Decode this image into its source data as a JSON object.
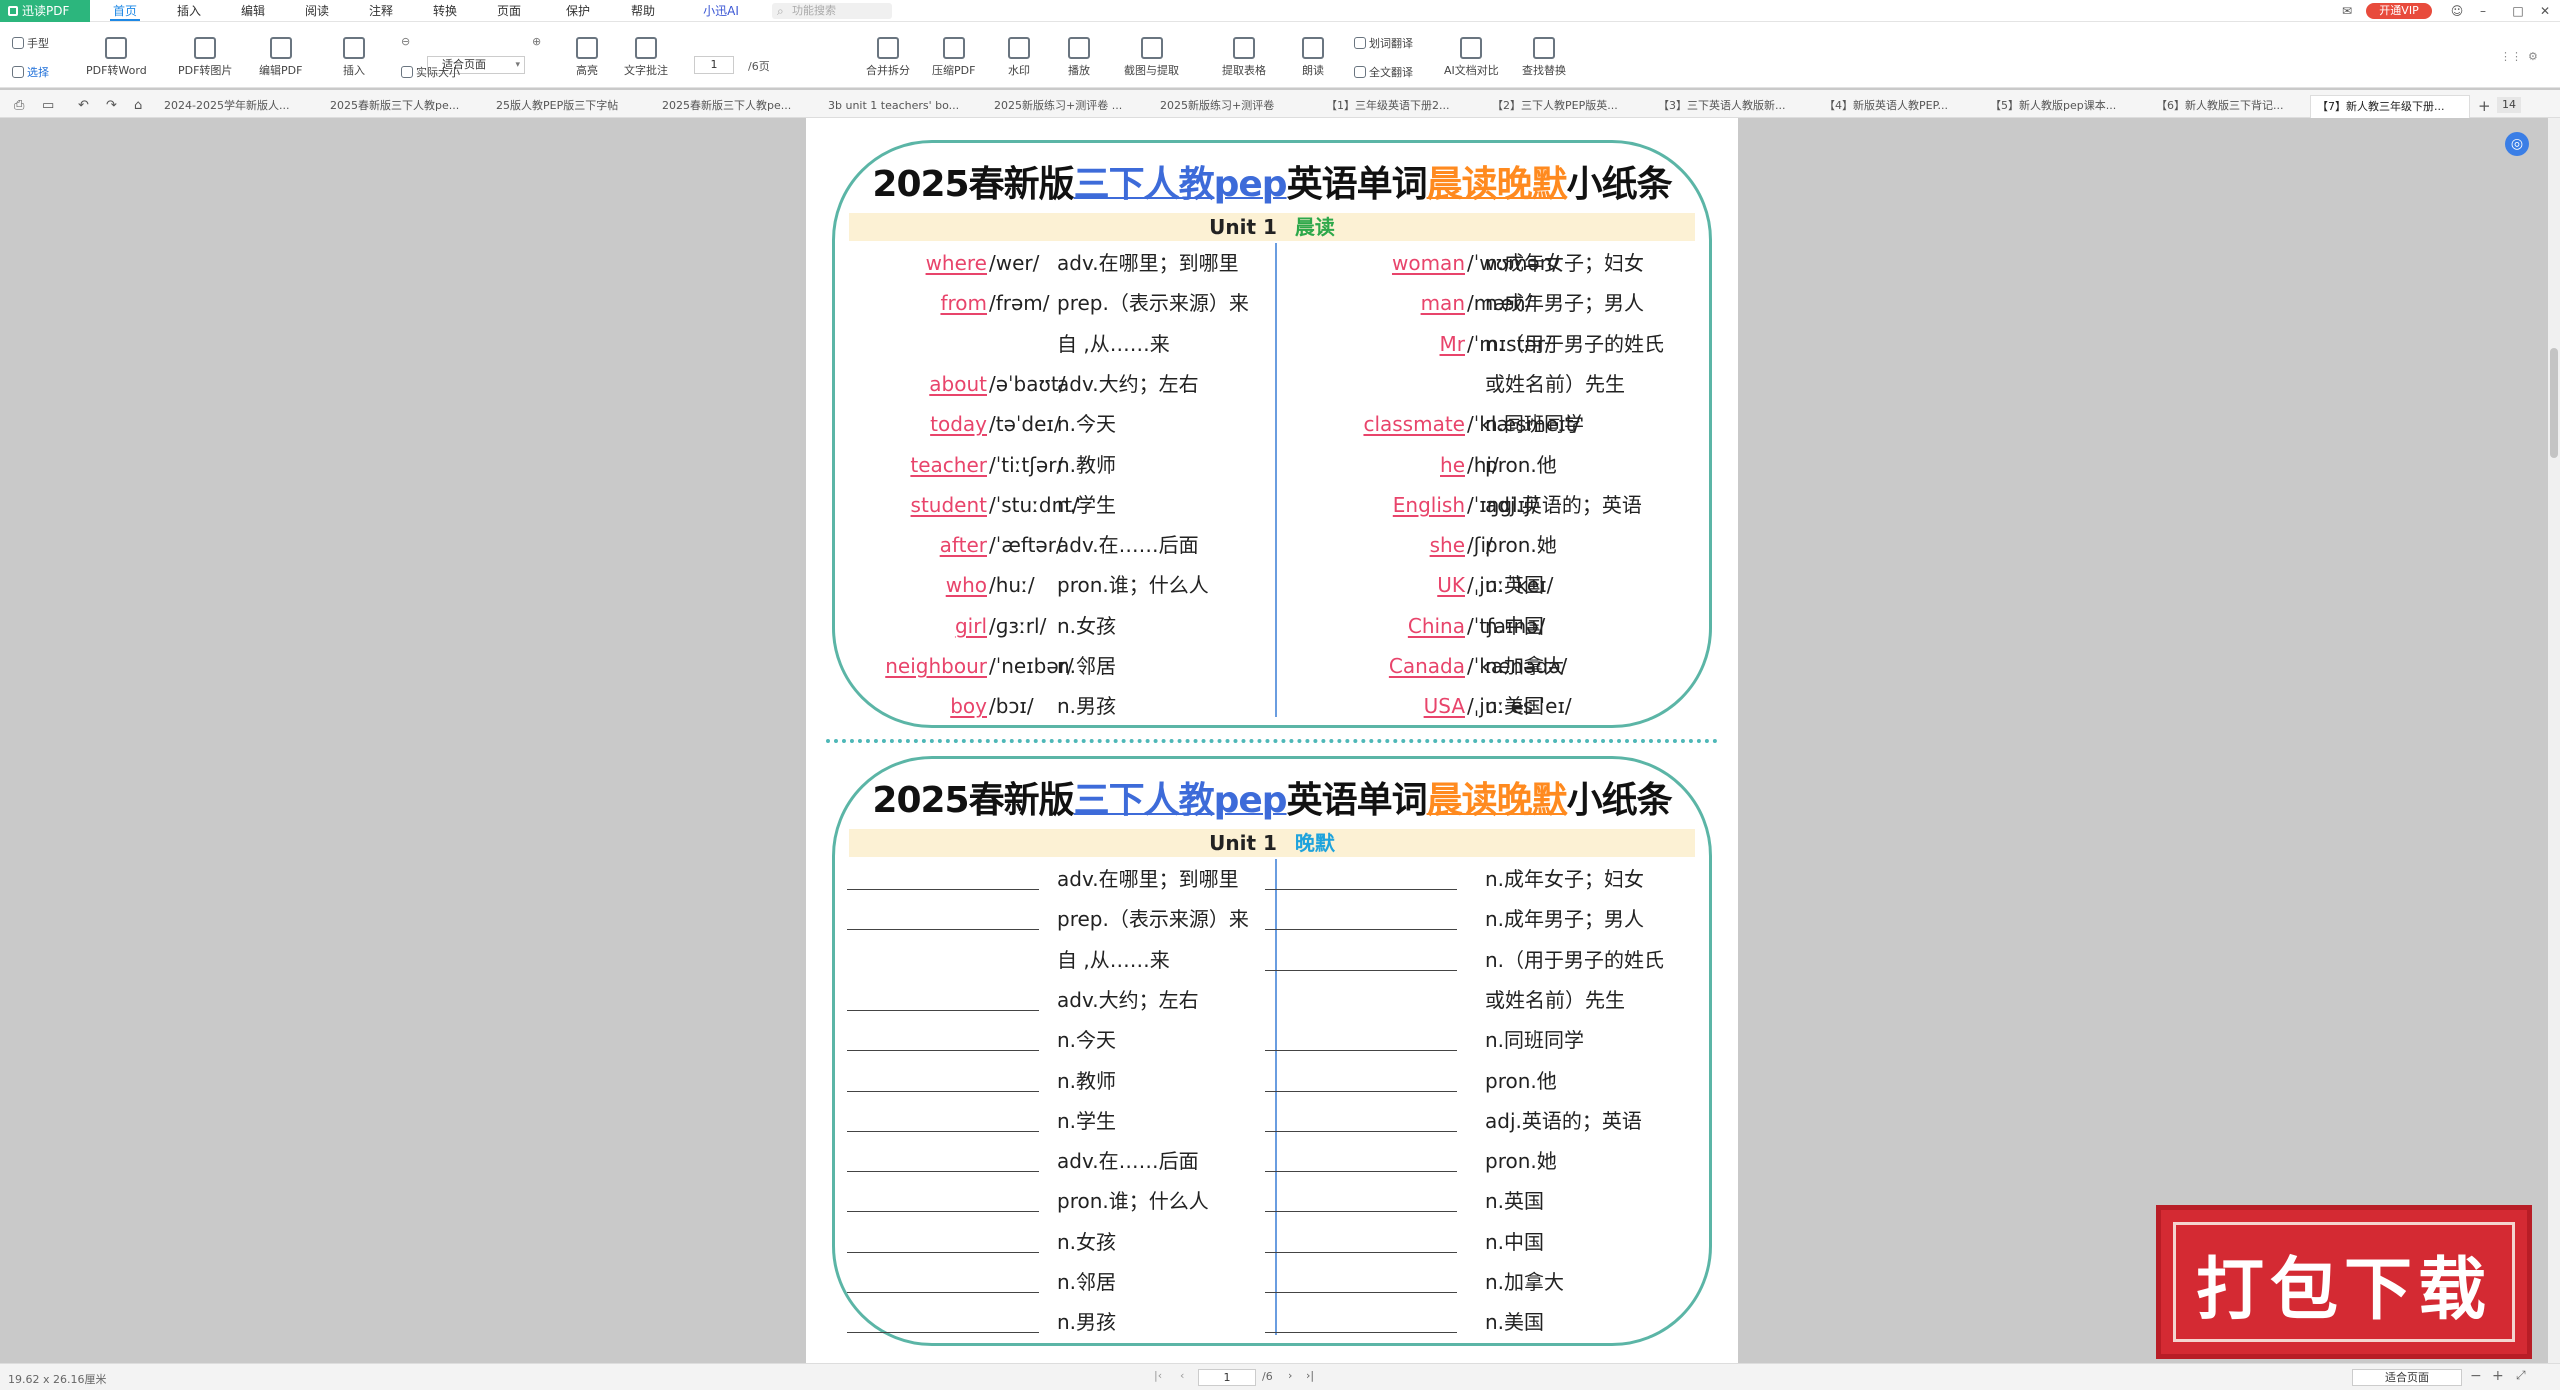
{
  "app": {
    "title": "迅读PDF",
    "vip": "开通VIP",
    "search_placeholder": "功能搜索",
    "menu": [
      "首页",
      "插入",
      "编辑",
      "阅读",
      "注释",
      "转换",
      "页面",
      "保护",
      "帮助",
      "小迅AI"
    ]
  },
  "ribbon": {
    "hand": "手型",
    "select": "选择",
    "to_word": "PDF转Word",
    "to_image": "PDF转图片",
    "edit": "编辑PDF",
    "insert": "插入",
    "actual_size": "实际大小",
    "fit": "适合页面",
    "highlight": "高亮",
    "text_note": "文字批注",
    "page": "1",
    "total": "/6页",
    "merge": "合并拆分",
    "compress": "压缩PDF",
    "watermark": "水印",
    "play": "播放",
    "screenshot": "截图与提取",
    "extract_table": "提取表格",
    "read": "朗读",
    "word_translate": "划词翻译",
    "full_translate": "全文翻译",
    "ai_compare": "AI文档对比",
    "find_replace": "查找替换"
  },
  "tabs": [
    "2024-2025学年新版人...",
    "2025春新版三下人教pe...",
    "25版人教PEP版三下字帖",
    "2025春新版三下人教pe...",
    "3b unit 1 teachers' bo...",
    "2025新版练习+测评卷 ...",
    "2025新版练习+测评卷",
    "【1】三年级英语下册2...",
    "【2】三下人教PEP版英...",
    "【3】三下英语人教版新...",
    "【4】新版英语人教PEP...",
    "【5】新人教版pep课本...",
    "【6】新人教版三下背记...",
    "【7】新人教三年级下册..."
  ],
  "tab_count": "14",
  "doc": {
    "title_a": "2025春新版",
    "title_b": "三下人教pep",
    "title_c": "英语单词",
    "title_d": "晨读晚默",
    "title_e": "小纸条",
    "unit": "Unit 1",
    "morning": "晨读",
    "evening": "晚默",
    "left": [
      {
        "w": "where",
        "p": "/wer/",
        "m": "adv.在哪里；到哪里"
      },
      {
        "w": "from",
        "p": "/frəm/",
        "m": "prep.（表示来源）来"
      },
      {
        "w": "",
        "p": "",
        "m": "自 ,从……来"
      },
      {
        "w": "about",
        "p": "/əˈbaʊt/",
        "m": "adv.大约；左右"
      },
      {
        "w": "today",
        "p": "/təˈdeɪ/",
        "m": "n.今天"
      },
      {
        "w": "teacher",
        "p": "/ˈtiːtʃər/",
        "m": "n.教师"
      },
      {
        "w": "student",
        "p": "/ˈstuːdnt/",
        "m": "n.学生"
      },
      {
        "w": "after",
        "p": "/ˈæftər/",
        "m": "adv.在……后面"
      },
      {
        "w": "who",
        "p": "/huː/",
        "m": "pron.谁；什么人"
      },
      {
        "w": "girl",
        "p": "/ɡɜːrl/",
        "m": "n.女孩"
      },
      {
        "w": "neighbour",
        "p": "/ˈneɪbər/",
        "m": "n.邻居"
      },
      {
        "w": "boy",
        "p": "/bɔɪ/",
        "m": "n.男孩"
      }
    ],
    "right": [
      {
        "w": "woman",
        "p": "/ˈwʊmən/",
        "m": "n.成年女子；妇女"
      },
      {
        "w": "man",
        "p": "/mæn/",
        "m": "n.成年男子；男人"
      },
      {
        "w": "Mr",
        "p": "/ˈmɪstər/",
        "m": "n.（用于男子的姓氏"
      },
      {
        "w": "",
        "p": "",
        "m": "或姓名前）先生"
      },
      {
        "w": "classmate",
        "p": "/ˈklæsmeɪt/",
        "m": "n.同班同学"
      },
      {
        "w": "he",
        "p": "/hi/",
        "m": "pron.他"
      },
      {
        "w": "English",
        "p": "/ˈɪŋɡlɪʃ/",
        "m": "adj.英语的；英语"
      },
      {
        "w": "she",
        "p": "/ʃi/",
        "m": "pron.她"
      },
      {
        "w": "UK",
        "p": "/ˌjuː ˈkeɪ/",
        "m": "n.英国"
      },
      {
        "w": "China",
        "p": "/ˈtʃaɪnə/",
        "m": "n.中国"
      },
      {
        "w": "Canada",
        "p": "/ˈkænədə/",
        "m": "n.加拿大"
      },
      {
        "w": "USA",
        "p": "/ˌjuː es ˈeɪ/",
        "m": "n.美国"
      }
    ]
  },
  "stamp": "打包下载",
  "status": {
    "size": "19.62 x 26.16厘米",
    "page": "1",
    "total": "/6",
    "zoom": "适合页面"
  }
}
